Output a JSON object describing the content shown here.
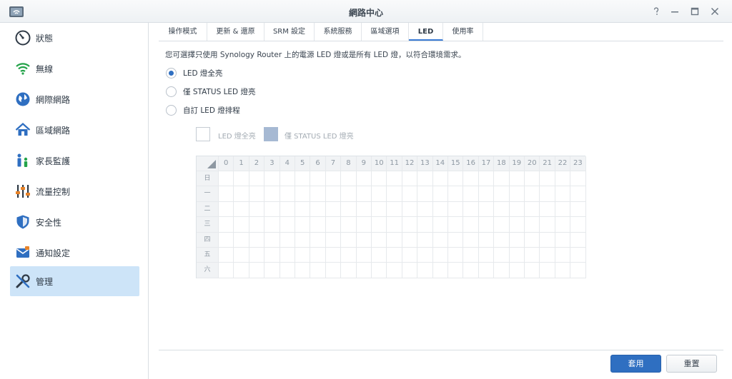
{
  "window": {
    "title": "網路中心",
    "buttons": [
      "help-icon",
      "minimize-icon",
      "maximize-icon",
      "close-icon"
    ]
  },
  "sidebar": {
    "items": [
      {
        "label": "狀態",
        "icon": "gauge-icon"
      },
      {
        "label": "無線",
        "icon": "wifi-icon"
      },
      {
        "label": "網際網路",
        "icon": "globe-icon"
      },
      {
        "label": "區域網路",
        "icon": "home-icon"
      },
      {
        "label": "家長監護",
        "icon": "family-icon"
      },
      {
        "label": "流量控制",
        "icon": "sliders-icon"
      },
      {
        "label": "安全性",
        "icon": "shield-icon"
      },
      {
        "label": "通知設定",
        "icon": "mail-icon"
      },
      {
        "label": "管理",
        "icon": "tools-icon",
        "active": true
      }
    ]
  },
  "tabs": [
    {
      "label": "操作模式"
    },
    {
      "label": "更新 & 還原"
    },
    {
      "label": "SRM 設定"
    },
    {
      "label": "系統服務"
    },
    {
      "label": "區域選項"
    },
    {
      "label": "LED",
      "active": true
    },
    {
      "label": "使用率"
    }
  ],
  "led": {
    "description": "您可選擇只使用 Synology Router 上的電源 LED 燈或是所有 LED 燈，以符合環境需求。",
    "options": [
      {
        "label": "LED 燈全亮",
        "selected": true
      },
      {
        "label": "僅 STATUS LED 燈亮",
        "selected": false
      },
      {
        "label": "自訂 LED 燈排程",
        "selected": false
      }
    ],
    "legend": {
      "all_on": "LED 燈全亮",
      "status_only": "僅 STATUS LED 燈亮"
    },
    "schedule": {
      "hours": [
        "0",
        "1",
        "2",
        "3",
        "4",
        "5",
        "6",
        "7",
        "8",
        "9",
        "10",
        "11",
        "12",
        "13",
        "14",
        "15",
        "16",
        "17",
        "18",
        "19",
        "20",
        "21",
        "22",
        "23"
      ],
      "days": [
        "日",
        "一",
        "二",
        "三",
        "四",
        "五",
        "六"
      ]
    }
  },
  "footer": {
    "apply_label": "套用",
    "reset_label": "重置"
  },
  "colors": {
    "accent": "#2f6fc1",
    "active_nav": "#cde4f8",
    "status_fill": "#a6b9d3"
  }
}
